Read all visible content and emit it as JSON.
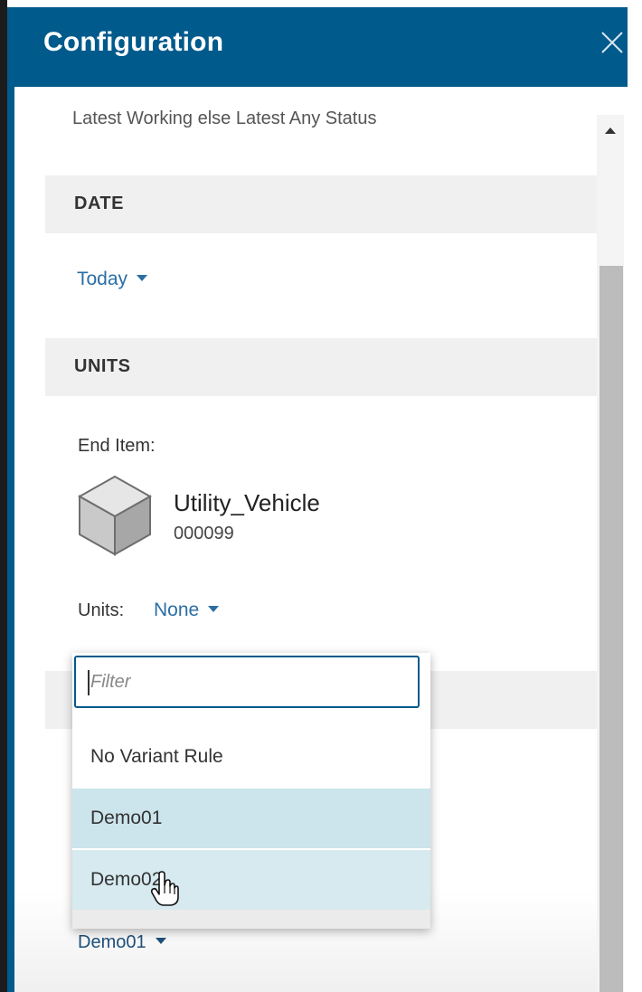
{
  "panel": {
    "title": "Configuration",
    "close_icon": "close-icon"
  },
  "revision_rule": {
    "value_text": "Latest Working else Latest Any Status"
  },
  "date_section": {
    "header": "DATE",
    "value": "Today"
  },
  "units_section": {
    "header": "UNITS",
    "end_item_label": "End Item:",
    "end_item": {
      "icon": "cube-icon",
      "name": "Utility_Vehicle",
      "id": "000099"
    },
    "units_label": "Units:",
    "units_value": "None"
  },
  "variant_dropdown": {
    "filter_placeholder": "Filter",
    "options": [
      {
        "label": "No Variant Rule",
        "state": "normal"
      },
      {
        "label": "Demo01",
        "state": "selected"
      },
      {
        "label": "Demo02",
        "state": "hover"
      }
    ],
    "current_value": "Demo01"
  },
  "colors": {
    "header_bg": "#005a8c",
    "link": "#2b6ea4",
    "section_bg": "#f0f0f0",
    "option_selected": "#cce4ec"
  }
}
